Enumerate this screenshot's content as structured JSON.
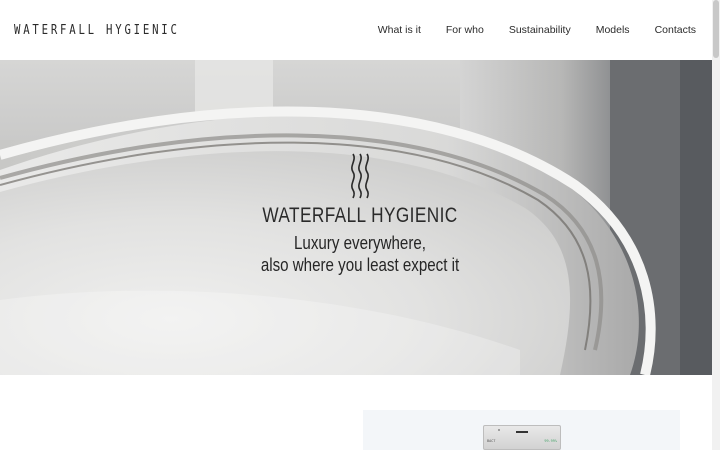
{
  "header": {
    "logo_text": "WATERFALL HYGIENIC",
    "nav": [
      {
        "label": "What is it"
      },
      {
        "label": "For who"
      },
      {
        "label": "Sustainability"
      },
      {
        "label": "Models"
      },
      {
        "label": "Contacts"
      }
    ]
  },
  "hero": {
    "title": "WATERFALL HYGIENIC",
    "tagline_line1": "Luxury everywhere,",
    "tagline_line2": "also where you least expect it"
  },
  "product": {
    "device_label_left": "BACT",
    "device_label_right": "99.99%"
  },
  "colors": {
    "header_bg": "#ffffff",
    "text": "#2a2a2a",
    "card_bg": "#f3f6f9"
  },
  "icons": {
    "brand": "wavy-lines-icon"
  }
}
